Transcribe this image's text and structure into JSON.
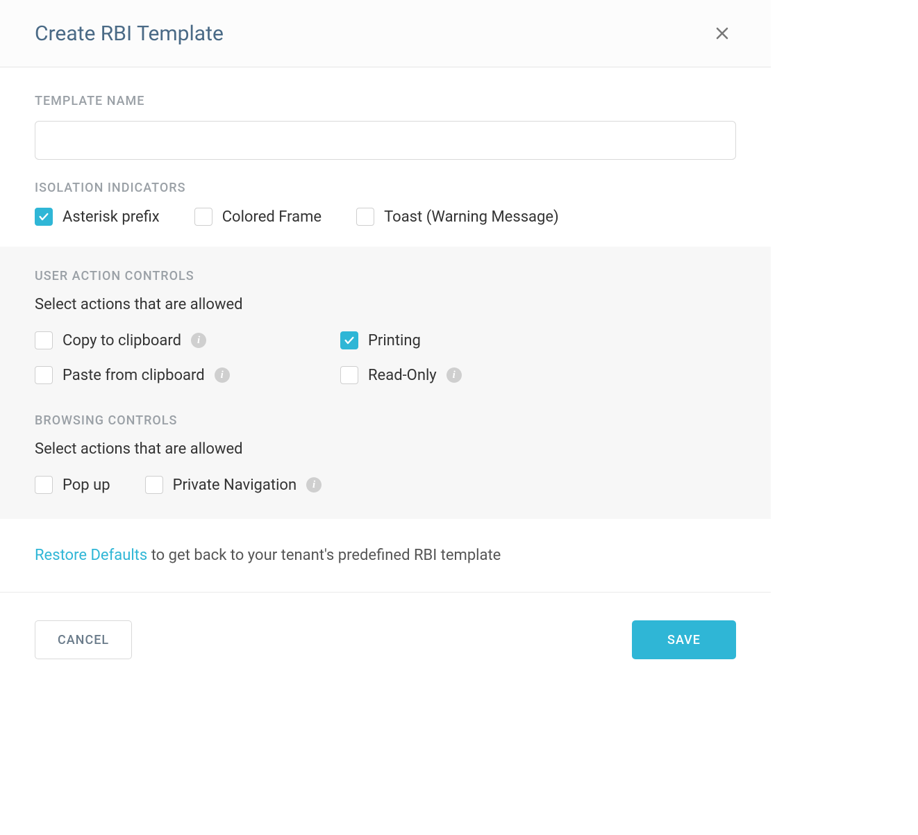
{
  "dialog": {
    "title": "Create RBI Template",
    "template_name": {
      "heading": "TEMPLATE NAME",
      "value": "",
      "placeholder": ""
    },
    "isolation_indicators": {
      "heading": "ISOLATION INDICATORS",
      "options": [
        {
          "label": "Asterisk prefix",
          "checked": true
        },
        {
          "label": "Colored Frame",
          "checked": false
        },
        {
          "label": "Toast (Warning Message)",
          "checked": false
        }
      ]
    },
    "user_action_controls": {
      "heading": "USER ACTION CONTROLS",
      "sub": "Select actions that are allowed",
      "options": [
        {
          "label": "Copy to clipboard",
          "checked": false,
          "info": true
        },
        {
          "label": "Printing",
          "checked": true,
          "info": false
        },
        {
          "label": "Paste from clipboard",
          "checked": false,
          "info": true
        },
        {
          "label": "Read-Only",
          "checked": false,
          "info": true
        }
      ]
    },
    "browsing_controls": {
      "heading": "BROWSING CONTROLS",
      "sub": "Select actions that are allowed",
      "options": [
        {
          "label": "Pop up",
          "checked": false,
          "info": false
        },
        {
          "label": "Private Navigation",
          "checked": false,
          "info": true
        }
      ]
    },
    "restore": {
      "link": "Restore Defaults",
      "text": " to get back to your tenant's predefined RBI template"
    },
    "buttons": {
      "cancel": "CANCEL",
      "save": "SAVE"
    }
  },
  "colors": {
    "accent": "#2fb6d6",
    "heading": "#4a6a86",
    "muted": "#9aa0a6"
  }
}
